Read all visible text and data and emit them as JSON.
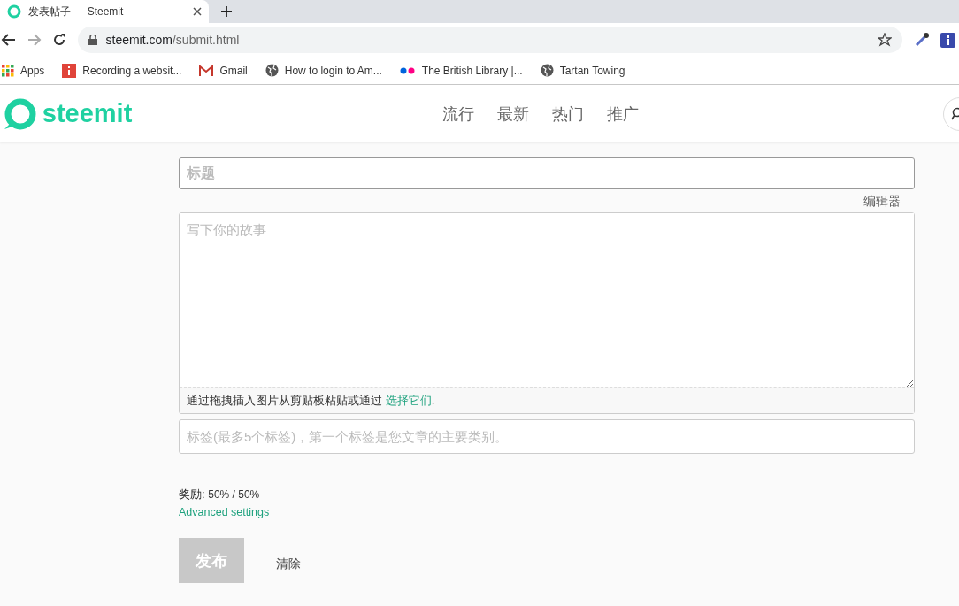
{
  "browser": {
    "tab_title": "发表帖子 — Steemit",
    "url_host": "steemit.com",
    "url_path": "/submit.html",
    "bookmarks": [
      {
        "label": "Apps",
        "kind": "apps"
      },
      {
        "label": "Recording a websit...",
        "kind": "red"
      },
      {
        "label": "Gmail",
        "kind": "gmail"
      },
      {
        "label": "How to login to Am...",
        "kind": "globe"
      },
      {
        "label": "The British Library |...",
        "kind": "dots"
      },
      {
        "label": "Tartan Towing",
        "kind": "globe"
      }
    ]
  },
  "header": {
    "logo": "steemit",
    "nav": [
      "流行",
      "最新",
      "热门",
      "推广"
    ]
  },
  "editor": {
    "title_placeholder": "标题",
    "editor_toggle": "编辑器",
    "body_placeholder": "写下你的故事",
    "drop_hint": {
      "prefix": "通过拖拽插入图片从剪贴板粘贴或通过 ",
      "link": "选择它们",
      "suffix": "."
    },
    "tags_placeholder": "标签(最多5个标签)，第一个标签是您文章的主要类别。",
    "reward_label": "奖励:",
    "reward_value": "50% / 50%",
    "advanced": "Advanced settings",
    "publish": {
      "label": "发布",
      "disabled": true
    },
    "clear": "清除"
  }
}
